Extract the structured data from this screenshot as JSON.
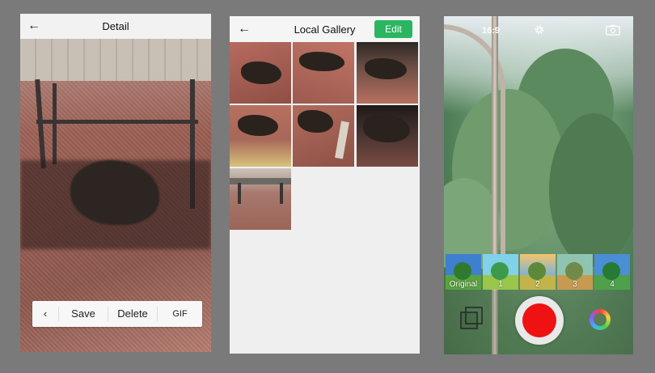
{
  "detail": {
    "title": "Detail",
    "back_icon": "arrow-left-icon",
    "toolbar": {
      "prev_icon": "chevron-left-icon",
      "save_label": "Save",
      "delete_label": "Delete",
      "gif_label": "GIF"
    }
  },
  "gallery": {
    "title": "Local Gallery",
    "back_icon": "arrow-left-icon",
    "edit_label": "Edit",
    "accent": "#2bb560",
    "thumbnails": [
      "photo-1",
      "photo-2",
      "photo-3",
      "photo-4",
      "photo-5",
      "photo-6",
      "photo-7"
    ]
  },
  "camera": {
    "aspect_ratio": "16:9",
    "settings_icon": "gear-icon",
    "switch_camera_icon": "camera-switch-icon",
    "filters": [
      {
        "label": "Original"
      },
      {
        "label": "1"
      },
      {
        "label": "2"
      },
      {
        "label": "3"
      },
      {
        "label": "4"
      }
    ],
    "record_color": "#ee1212",
    "gallery_icon": "gallery-stack-icon",
    "effects_icon": "color-ring-icon"
  }
}
